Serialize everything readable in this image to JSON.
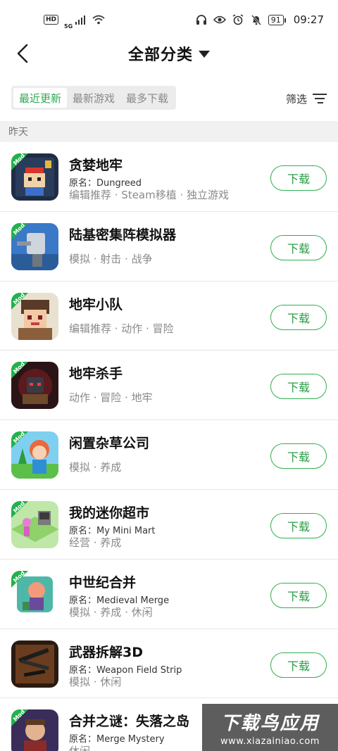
{
  "status_bar": {
    "hd": "HD",
    "net": "5G",
    "battery": "91",
    "time": "09:27",
    "icons": [
      "headphones-icon",
      "eye-icon",
      "alarm-icon",
      "bell-off-icon"
    ]
  },
  "header": {
    "title": "全部分类",
    "back_icon": "chevron-left-icon",
    "dropdown_icon": "caret-down-icon"
  },
  "tabs": [
    {
      "label": "最近更新",
      "active": true
    },
    {
      "label": "最新游戏",
      "active": false
    },
    {
      "label": "最多下载",
      "active": false
    }
  ],
  "filter": {
    "label": "筛选",
    "icon": "filter-icon"
  },
  "section_label": "昨天",
  "badge": "Mod",
  "download_label": "下载",
  "apps": [
    {
      "name": "贪婪地牢",
      "original": "原名：Dungreed",
      "tags": "编辑推荐 · Steam移植 · 独立游戏"
    },
    {
      "name": "陆基密集阵模拟器",
      "original": "",
      "tags": "模拟 · 射击 · 战争"
    },
    {
      "name": "地牢小队",
      "original": "",
      "tags": "编辑推荐 · 动作 · 冒险"
    },
    {
      "name": "地牢杀手",
      "original": "",
      "tags": "动作 · 冒险 · 地牢"
    },
    {
      "name": "闲置杂草公司",
      "original": "",
      "tags": "模拟 · 养成"
    },
    {
      "name": "我的迷你超市",
      "original": "原名：My Mini Mart",
      "tags": "经营 · 养成"
    },
    {
      "name": "中世纪合并",
      "original": "原名：Medieval Merge",
      "tags": "模拟 · 养成 · 休闲"
    },
    {
      "name": "武器拆解3D",
      "original": "原名：Weapon Field Strip",
      "tags": "模拟 · 休闲"
    },
    {
      "name": "合并之谜：失落之岛",
      "original": "原名：Merge Mystery",
      "tags": "休闲"
    }
  ],
  "watermark": {
    "title": "下载鸟应用",
    "url": "www.xiazainiao.com"
  },
  "colors": {
    "accent": "#2fa84f",
    "tag_gray": "#8a8a8a",
    "section_bg": "#f1f1f1"
  }
}
